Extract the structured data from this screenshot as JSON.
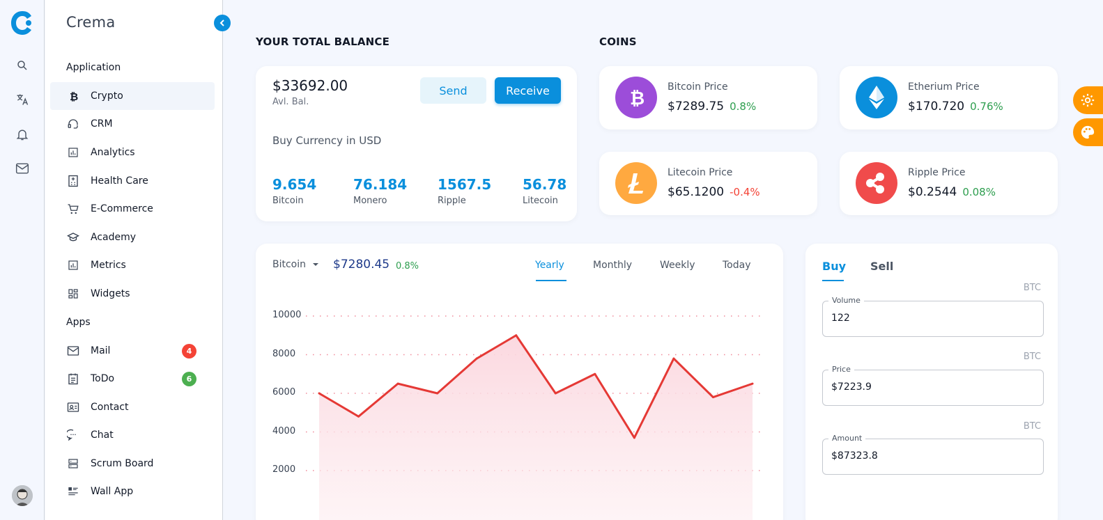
{
  "app": {
    "brand": "Crema"
  },
  "sidebar": {
    "sections": [
      {
        "title": "Application"
      },
      {
        "title": "Apps"
      }
    ],
    "application_items": [
      {
        "label": "Crypto",
        "icon": "bitcoin-icon",
        "active": true
      },
      {
        "label": "CRM",
        "icon": "headset-icon"
      },
      {
        "label": "Analytics",
        "icon": "bar-chart-icon"
      },
      {
        "label": "Health Care",
        "icon": "hospital-icon"
      },
      {
        "label": "E-Commerce",
        "icon": "cart-icon"
      },
      {
        "label": "Academy",
        "icon": "graduation-cap-icon"
      },
      {
        "label": "Metrics",
        "icon": "bar-chart-icon"
      },
      {
        "label": "Widgets",
        "icon": "widgets-icon"
      }
    ],
    "apps_items": [
      {
        "label": "Mail",
        "icon": "mail-icon",
        "badge": "4",
        "badge_color": "#f44336"
      },
      {
        "label": "ToDo",
        "icon": "clipboard-icon",
        "badge": "6",
        "badge_color": "#4caf50"
      },
      {
        "label": "Contact",
        "icon": "contact-card-icon"
      },
      {
        "label": "Chat",
        "icon": "chat-icon"
      },
      {
        "label": "Scrum Board",
        "icon": "board-icon"
      },
      {
        "label": "Wall App",
        "icon": "feed-icon"
      }
    ]
  },
  "balance": {
    "heading": "YOUR TOTAL BALANCE",
    "amount": "$33692.00",
    "sub": "Avl. Bal.",
    "send_label": "Send",
    "receive_label": "Receive",
    "buy_title": "Buy Currency in USD",
    "currencies": [
      {
        "value": "9.654",
        "name": "Bitcoin"
      },
      {
        "value": "76.184",
        "name": "Monero"
      },
      {
        "value": "1567.5",
        "name": "Ripple"
      },
      {
        "value": "56.78",
        "name": "Litecoin"
      }
    ]
  },
  "coins": {
    "heading": "COINS",
    "items": [
      {
        "name": "Bitcoin Price",
        "price": "$7289.75",
        "change": "0.8%",
        "change_color": "#2e9e4f",
        "color": "#9c4dd9",
        "icon": "bitcoin-icon"
      },
      {
        "name": "Etherium Price",
        "price": "$170.720",
        "change": "0.76%",
        "change_color": "#2e9e4f",
        "color": "#0a8fdc",
        "icon": "ethereum-icon"
      },
      {
        "name": "Litecoin Price",
        "price": "$65.1200",
        "change": "-0.4%",
        "change_color": "#f44336",
        "color": "#ffa940",
        "icon": "litecoin-icon"
      },
      {
        "name": "Ripple Price",
        "price": "$0.2544",
        "change": "0.08%",
        "change_color": "#2e9e4f",
        "color": "#f04b4b",
        "icon": "ripple-icon"
      }
    ]
  },
  "chart_panel": {
    "selected_coin": "Bitcoin",
    "price": "$7280.45",
    "change": "0.8%",
    "tabs": [
      "Yearly",
      "Monthly",
      "Weekly",
      "Today"
    ],
    "active_tab": "Yearly"
  },
  "chart_data": {
    "type": "area",
    "title": "",
    "xlabel": "",
    "ylabel": "",
    "ylim": [
      0,
      10000
    ],
    "yticks": [
      10000,
      8000,
      6000,
      4000,
      2000
    ],
    "grid": true,
    "series": [
      {
        "values": [
          6000,
          4800,
          6500,
          6000,
          7800,
          9000,
          6000,
          7000,
          3700,
          7800,
          5800,
          6500
        ],
        "color": "#e53935"
      }
    ]
  },
  "trade": {
    "tabs": [
      "Buy",
      "Sell"
    ],
    "active_tab": "Buy",
    "fields": [
      {
        "label": "Volume",
        "value": "122",
        "unit": "BTC"
      },
      {
        "label": "Price",
        "value": "$7223.9",
        "unit": "BTC"
      },
      {
        "label": "Amount",
        "value": "$87323.8",
        "unit": "BTC"
      }
    ]
  }
}
